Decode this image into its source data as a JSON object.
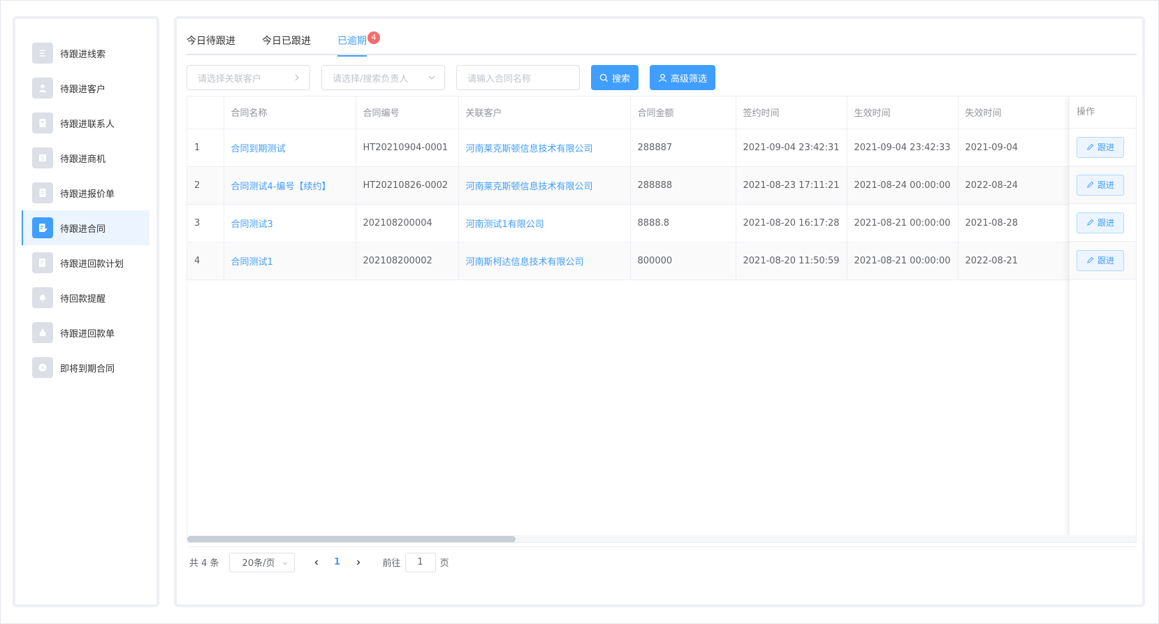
{
  "sidebar": {
    "items": [
      {
        "label": "待跟进线索",
        "icon": "clue-icon"
      },
      {
        "label": "待跟进客户",
        "icon": "customer-icon"
      },
      {
        "label": "待跟进联系人",
        "icon": "contact-icon"
      },
      {
        "label": "待跟进商机",
        "icon": "opportunity-icon"
      },
      {
        "label": "待跟进报价单",
        "icon": "quote-icon"
      },
      {
        "label": "待跟进合同",
        "icon": "contract-icon",
        "active": true
      },
      {
        "label": "待跟进回款计划",
        "icon": "payment-plan-icon"
      },
      {
        "label": "待回款提醒",
        "icon": "bell-icon"
      },
      {
        "label": "待跟进回款单",
        "icon": "money-bag-icon"
      },
      {
        "label": "即将到期合同",
        "icon": "clock-icon"
      }
    ]
  },
  "tabs": [
    {
      "label": "今日待跟进"
    },
    {
      "label": "今日已跟进"
    },
    {
      "label": "已逾期",
      "badge": "4",
      "active": true
    }
  ],
  "filters": {
    "customer_placeholder": "请选择关联客户",
    "owner_placeholder": "请选择/搜索负责人",
    "contract_placeholder": "请输入合同名称",
    "search_label": "搜索",
    "advanced_label": "高级筛选"
  },
  "table": {
    "columns": [
      "",
      "合同名称",
      "合同编号",
      "关联客户",
      "合同金额",
      "签约时间",
      "生效时间",
      "失效时间"
    ],
    "action_header": "操作",
    "action_label": "跟进",
    "rows": [
      {
        "index": "1",
        "name": "合同到期测试",
        "code": "HT20210904-0001",
        "customer": "河南莱克斯顿信息技术有限公司",
        "amount": "288887",
        "signed": "2021-09-04 23:42:31",
        "effective": "2021-09-04 23:42:33",
        "expire": "2021-09-04"
      },
      {
        "index": "2",
        "name": "合同测试4-编号【续约】",
        "code": "HT20210826-0002",
        "customer": "河南莱克斯顿信息技术有限公司",
        "amount": "288888",
        "signed": "2021-08-23 17:11:21",
        "effective": "2021-08-24 00:00:00",
        "expire": "2022-08-24"
      },
      {
        "index": "3",
        "name": "合同测试3",
        "code": "202108200004",
        "customer": "河南测试1有限公司",
        "amount": "8888.8",
        "signed": "2021-08-20 16:17:28",
        "effective": "2021-08-21 00:00:00",
        "expire": "2021-08-28"
      },
      {
        "index": "4",
        "name": "合同测试1",
        "code": "202108200002",
        "customer": "河南斯柯达信息技术有限公司",
        "amount": "800000",
        "signed": "2021-08-20 11:50:59",
        "effective": "2021-08-21 00:00:00",
        "expire": "2022-08-21"
      }
    ]
  },
  "pagination": {
    "total": "共 4 条",
    "page_size": "20条/页",
    "current": "1",
    "goto_label": "前往",
    "goto_value": "1",
    "page_unit": "页"
  },
  "colors": {
    "accent": "#409eff",
    "badge": "#f56c6c"
  }
}
